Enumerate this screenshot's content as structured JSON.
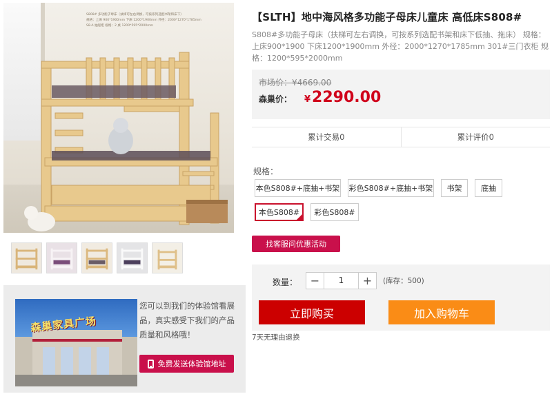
{
  "product": {
    "title": "【SLTH】地中海风格多功能子母床儿童床 高低床S808#",
    "description": "S808#多功能子母床（扶梯可左右调换，可按系列选配书架和床下低抽、拖床） 规格：上床900*1900 下床1200*1900mm 外径：2000*1270*1785mm 301#三门衣柜 规格：1200*595*2000mm",
    "image_caption_lines": [
      "S808# 多功能子母床（扶梯可左右调换，可按系列选配书架和床下）",
      "规格：上床 900*1900mm 下床 1200*1900mm 外径：2000*1270*1785mm",
      "S8-A 抽屉柜 规格：2 桌 1200*595*2000mm"
    ]
  },
  "price": {
    "market_label": "市场价：",
    "market_value": "¥4669.00",
    "sale_label": "森巢价：",
    "currency": "¥",
    "sale_value": "2290.00"
  },
  "stats": {
    "sales": "累计交易0",
    "reviews": "累计评价0"
  },
  "spec": {
    "label": "规格：",
    "options": [
      "本色S808#+底抽+书架",
      "彩色S808#+底抽+书架",
      "书架",
      "底抽",
      "本色S808#",
      "彩色S808#"
    ],
    "selected_index": 4
  },
  "consult_button": "找客服问优惠活动",
  "purchase": {
    "qty_label": "数量：",
    "minus": "−",
    "plus": "+",
    "qty": "1",
    "stock": "(库存：500)",
    "buy_now": "立即购买",
    "add_to_cart": "加入购物车",
    "return_note": "7天无理由退换"
  },
  "showroom": {
    "sign_text": "森巢家具广场",
    "text": "您可以到我们的体验馆看展品，真实感受下我们的产品质量和风格哦！",
    "button_label": "免费发送体验馆地址"
  },
  "colors": {
    "accent_red": "#d0021b",
    "buy_button": "#cc0000",
    "cart_button": "#fa8c16",
    "magenta_button": "#c9104b"
  }
}
